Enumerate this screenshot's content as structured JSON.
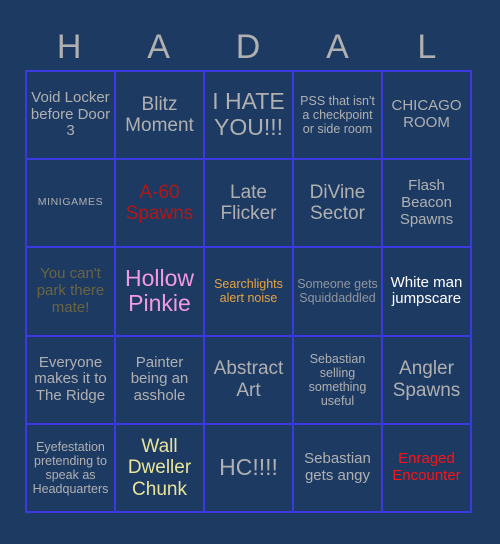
{
  "board": {
    "header_letters": [
      "H",
      "A",
      "D",
      "A",
      "L"
    ],
    "default_text_color": "#b0b0b0",
    "grid_line_color": "#3a3ae0",
    "background_color": "#1d3a63",
    "rows": [
      [
        {
          "text": "Void Locker before Door 3",
          "color": "#b0b0b0",
          "size": "fs-m"
        },
        {
          "text": "Blitz Moment",
          "color": "#b0b0b0",
          "size": "fs-l"
        },
        {
          "text": "I HATE YOU!!!",
          "color": "#b0b0b0",
          "size": "fs-xl"
        },
        {
          "text": "PSS that isn't a checkpoint or side room",
          "color": "#b0b0b0",
          "size": "fs-s"
        },
        {
          "text": "CHICAGO ROOM",
          "color": "#b0b0b0",
          "size": "fs-m"
        }
      ],
      [
        {
          "text": "MINIGAMES",
          "color": "#b0b0b0",
          "size": "fs-xs"
        },
        {
          "text": "A-60 Spawns",
          "color": "#b01818",
          "size": "fs-l"
        },
        {
          "text": "Late Flicker",
          "color": "#b0b0b0",
          "size": "fs-l"
        },
        {
          "text": "DiVine Sector",
          "color": "#b0b0b0",
          "size": "fs-l"
        },
        {
          "text": "Flash Beacon Spawns",
          "color": "#b0b0b0",
          "size": "fs-m"
        }
      ],
      [
        {
          "text": "You can't park there mate!",
          "color": "#6b6440",
          "size": "fs-m"
        },
        {
          "text": "Hollow Pinkie",
          "color": "#f49ae0",
          "size": "fs-xl"
        },
        {
          "text": "Searchlights alert noise",
          "color": "#e8a33d",
          "size": "fs-s"
        },
        {
          "text": "Someone gets Squiddaddled",
          "color": "#90969e",
          "size": "fs-s"
        },
        {
          "text": "White man jumpscare",
          "color": "#ffffff",
          "size": "fs-m"
        }
      ],
      [
        {
          "text": "Everyone makes it to The Ridge",
          "color": "#b0b0b0",
          "size": "fs-m"
        },
        {
          "text": "Painter being an asshole",
          "color": "#b0b0b0",
          "size": "fs-m"
        },
        {
          "text": "Abstract Art",
          "color": "#b0b0b0",
          "size": "fs-l"
        },
        {
          "text": "Sebastian selling something useful",
          "color": "#b0b0b0",
          "size": "fs-s"
        },
        {
          "text": "Angler Spawns",
          "color": "#b0b0b0",
          "size": "fs-l"
        }
      ],
      [
        {
          "text": "Eyefestation pretending to speak as Headquarters",
          "color": "#b0b0b0",
          "size": "fs-s"
        },
        {
          "text": "Wall Dweller Chunk",
          "color": "#e8e49a",
          "size": "fs-l"
        },
        {
          "text": "HC!!!!",
          "color": "#b0b0b0",
          "size": "fs-xl"
        },
        {
          "text": "Sebastian gets angy",
          "color": "#b0b0b0",
          "size": "fs-m"
        },
        {
          "text": "Enraged Encounter",
          "color": "#fc1414",
          "size": "fs-m"
        }
      ]
    ]
  }
}
